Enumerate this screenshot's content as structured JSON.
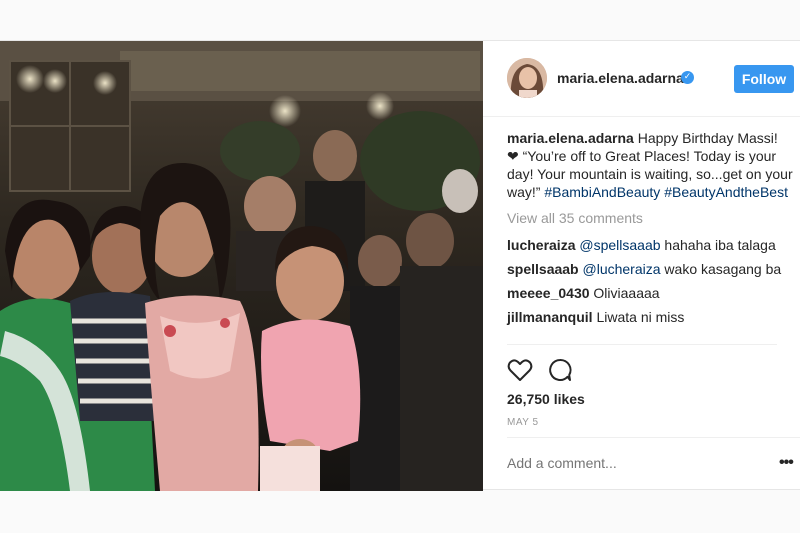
{
  "post": {
    "username": "maria.elena.adarna",
    "verified_icon": "verified-badge-icon",
    "follow_label": "Follow",
    "caption_user": "maria.elena.adarna",
    "caption_line1": "Happy Birthday Massi!",
    "caption_line2": "❤ “You’re off to Great Places! Today is your day! Your mountain is waiting, so...get on your way!”",
    "hashtag1": "#BambiAndBeauty",
    "hashtag2": "#BeautyAndtheBest",
    "view_all": "View all 35 comments",
    "comments": [
      {
        "user": "lucheraiza",
        "mention": "@spellsaaab",
        "text": "hahaha iba talaga"
      },
      {
        "user": "spellsaaab",
        "mention": "@lucheraiza",
        "text": "wako kasagang ba"
      },
      {
        "user": "meeee_0430",
        "mention": "",
        "text": "Oliviaaaaa"
      },
      {
        "user": "jillmananquil",
        "mention": "",
        "text": "Liwata ni miss"
      }
    ],
    "likes": "26,750 likes",
    "date": "MAY 5",
    "add_comment_placeholder": "Add a comment...",
    "more_label": "•••"
  },
  "colors": {
    "accent": "#3897f0",
    "hashtag": "#003569",
    "muted": "#999999"
  }
}
